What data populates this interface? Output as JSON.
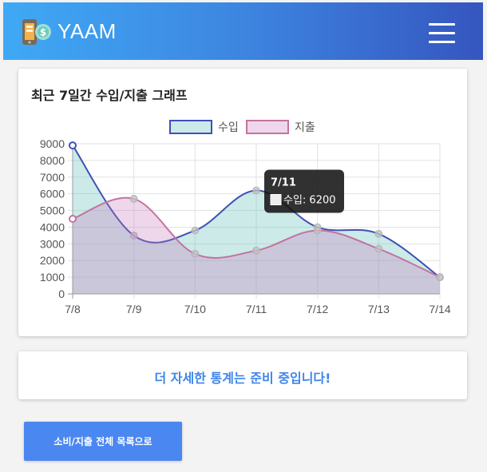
{
  "header": {
    "app_title": "YAAM",
    "logo_icon": "phone-coin-icon",
    "menu_icon": "hamburger-menu-icon"
  },
  "chart_card": {
    "title": "최근 7일간 수입/지출 그래프"
  },
  "chart_data": {
    "type": "area",
    "categories": [
      "7/8",
      "7/9",
      "7/10",
      "7/11",
      "7/12",
      "7/13",
      "7/14"
    ],
    "series": [
      {
        "name": "수입",
        "values": [
          8900,
          3500,
          3800,
          6200,
          4000,
          3600,
          1000
        ],
        "color": "#3f51b5"
      },
      {
        "name": "지출",
        "values": [
          4500,
          5700,
          2400,
          2600,
          3800,
          2700,
          1000
        ],
        "color": "#c2739f"
      }
    ],
    "ylim": [
      0,
      9000
    ],
    "yticks": [
      "0",
      "1000",
      "2000",
      "3000",
      "4000",
      "5000",
      "6000",
      "7000",
      "8000",
      "9000"
    ],
    "grid": true,
    "legend": "top",
    "tooltip": {
      "title": "7/11",
      "label": "수입: 6200"
    }
  },
  "info_card": {
    "text": "더 자세한 통계는 준비 중입니다!"
  },
  "list_button": {
    "label": "소비/지출 전체 목록으로"
  }
}
